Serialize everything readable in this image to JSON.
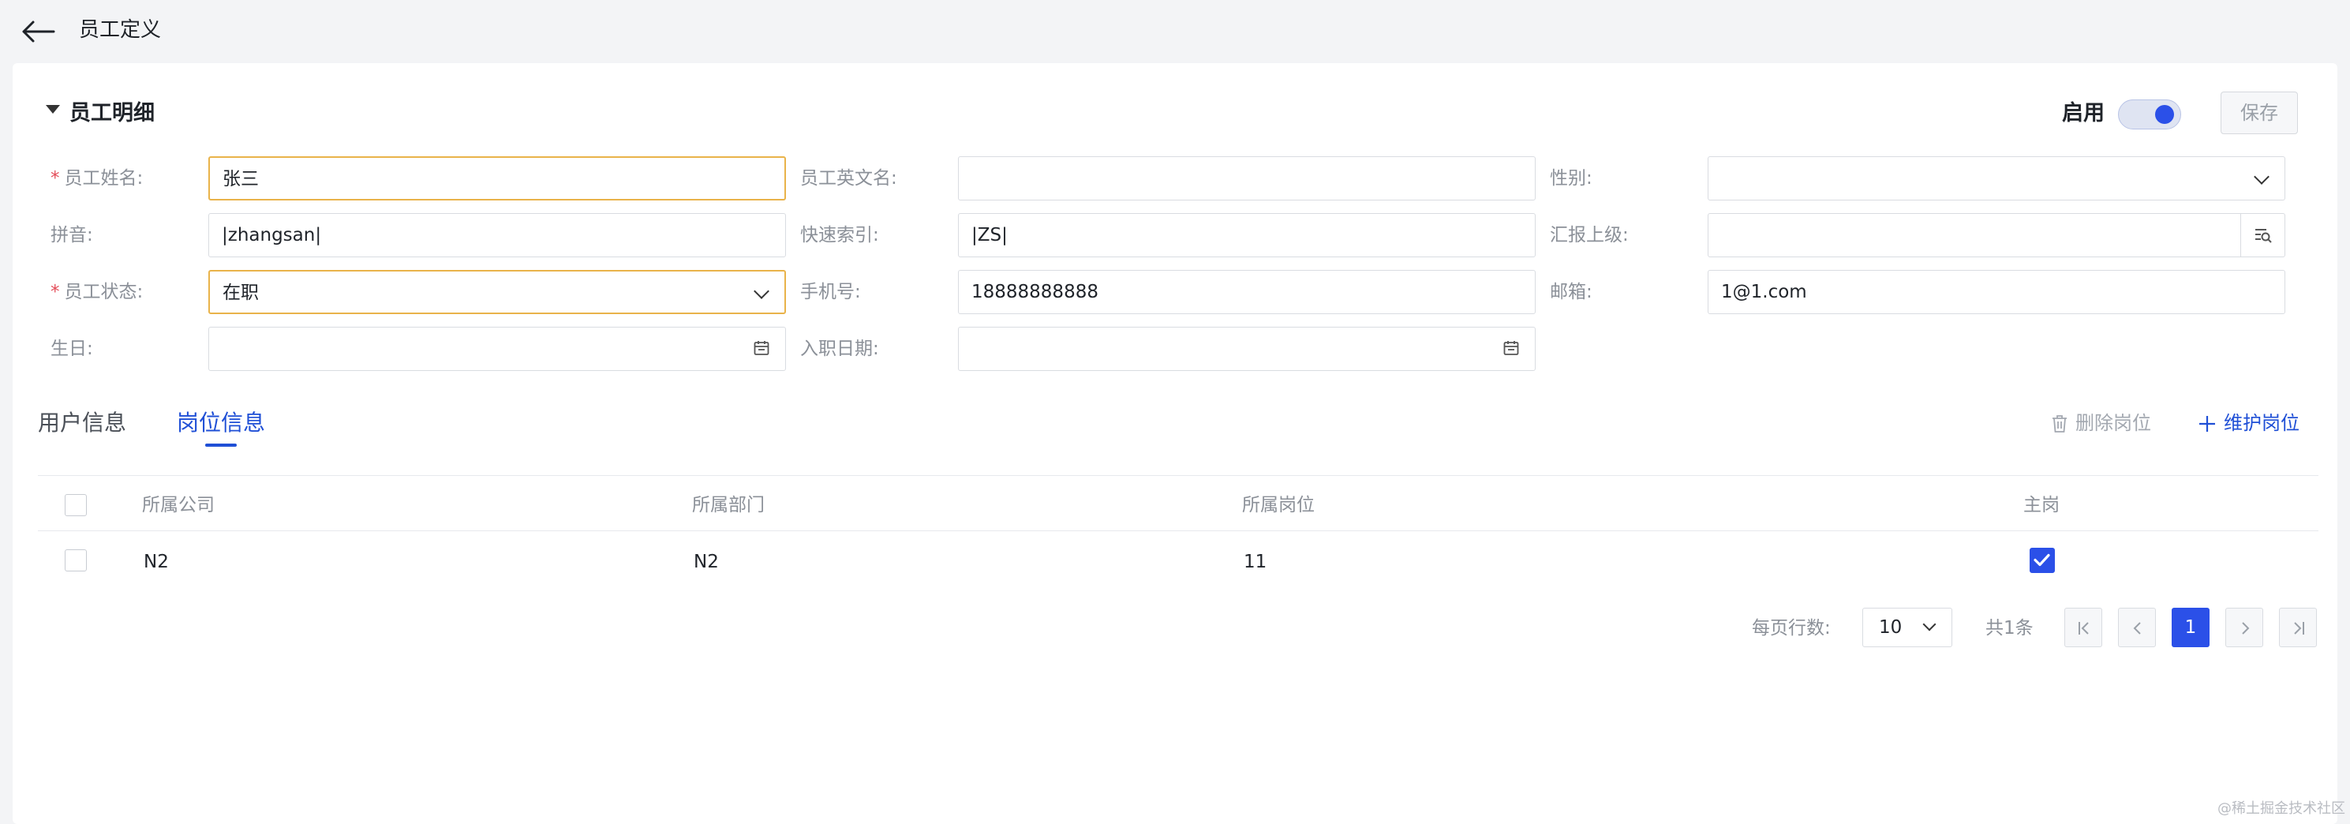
{
  "header": {
    "title": "员工定义"
  },
  "section": {
    "title": "员工明细",
    "enable_label": "启用",
    "enabled": true,
    "save_label": "保存"
  },
  "form": {
    "name": {
      "label": "员工姓名:",
      "value": "张三",
      "required": true
    },
    "english_name": {
      "label": "员工英文名:",
      "value": ""
    },
    "gender": {
      "label": "性别:",
      "value": ""
    },
    "pinyin": {
      "label": "拼音:",
      "value": "|zhangsan|"
    },
    "quick_index": {
      "label": "快速索引:",
      "value": "|ZS|"
    },
    "superior": {
      "label": "汇报上级:",
      "value": ""
    },
    "status": {
      "label": "员工状态:",
      "value": "在职",
      "required": true
    },
    "phone": {
      "label": "手机号:",
      "value": "18888888888"
    },
    "email": {
      "label": "邮箱:",
      "value": "1@1.com"
    },
    "birthday": {
      "label": "生日:",
      "value": ""
    },
    "hire_date": {
      "label": "入职日期:",
      "value": ""
    },
    "required_mark": "*"
  },
  "tabs": [
    {
      "label": "用户信息",
      "active": false
    },
    {
      "label": "岗位信息",
      "active": true
    }
  ],
  "actions": {
    "delete": "删除岗位",
    "maintain": "维护岗位"
  },
  "table": {
    "columns": [
      "所属公司",
      "所属部门",
      "所属岗位",
      "主岗"
    ],
    "rows": [
      {
        "company": "N2",
        "department": "N2",
        "post": "11",
        "primary": true
      }
    ]
  },
  "pagination": {
    "rows_per_page_label": "每页行数:",
    "page_size": "10",
    "total": "共1条",
    "current_page": "1"
  },
  "watermark": "@稀土掘金技术社区",
  "colors": {
    "accent": "#2b50e8",
    "focus_border": "#e9b34a",
    "required": "#e34d59"
  }
}
